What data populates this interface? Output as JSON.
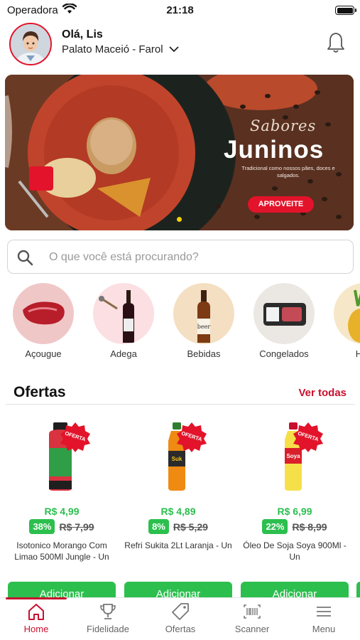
{
  "status_bar": {
    "carrier": "Operadora",
    "time": "21:18"
  },
  "header": {
    "greeting": "Olá, Lis",
    "store": "Palato Maceió - Farol"
  },
  "banner": {
    "subtitle": "Sabores",
    "title": "Juninos",
    "tagline": "Tradicional como nossos pães, doces e salgados.",
    "cta": "APROVEITE"
  },
  "search": {
    "placeholder": "O que você está procurando?"
  },
  "categories": [
    {
      "label": "Açougue"
    },
    {
      "label": "Adega"
    },
    {
      "label": "Bebidas"
    },
    {
      "label": "Congelados"
    },
    {
      "label": "Hort"
    }
  ],
  "offers": {
    "title": "Ofertas",
    "see_all": "Ver todas",
    "badge": "OFERTA",
    "products": [
      {
        "price": "R$ 4,99",
        "discount": "38%",
        "old_price": "R$ 7,99",
        "name": "Isotonico Morango Com Limao 500Ml Jungle - Un",
        "button": "Adicionar"
      },
      {
        "price": "R$ 4,89",
        "discount": "8%",
        "old_price": "R$ 5,29",
        "name": "Refri Sukita 2Lt Laranja - Un",
        "button": "Adicionar"
      },
      {
        "price": "R$ 6,99",
        "discount": "22%",
        "old_price": "R$ 8,99",
        "name": "Óleo De Soja Soya 900Ml - Un",
        "button": "Adicionar"
      }
    ]
  },
  "tabbar": [
    {
      "label": "Home",
      "icon": "home-icon",
      "active": true
    },
    {
      "label": "Fidelidade",
      "icon": "trophy-icon"
    },
    {
      "label": "Ofertas",
      "icon": "tag-icon"
    },
    {
      "label": "Scanner",
      "icon": "barcode-icon"
    },
    {
      "label": "Menu",
      "icon": "menu-icon"
    }
  ],
  "colors": {
    "brand_red": "#c8102e",
    "offer_green": "#2cbf4e"
  }
}
